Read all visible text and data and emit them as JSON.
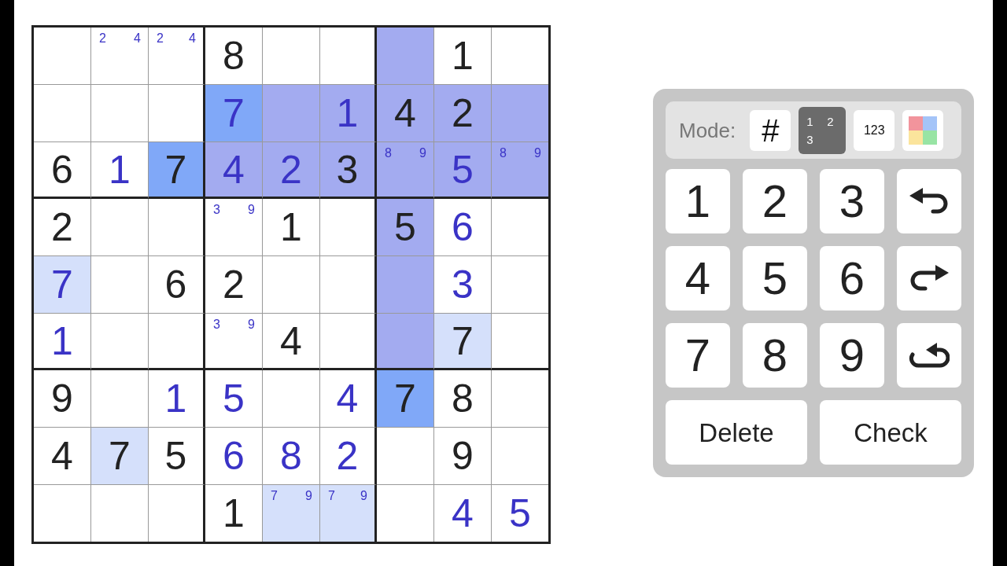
{
  "grid": {
    "rows": [
      [
        {
          "kind": "empty",
          "color": "#ffffff"
        },
        {
          "kind": "pencil",
          "marks": [
            "2",
            "4"
          ],
          "color": "#ffffff"
        },
        {
          "kind": "pencil",
          "marks": [
            "2",
            "4"
          ],
          "color": "#ffffff"
        },
        {
          "kind": "given",
          "value": "8",
          "color": "#ffffff"
        },
        {
          "kind": "empty",
          "color": "#ffffff"
        },
        {
          "kind": "empty",
          "color": "#ffffff"
        },
        {
          "kind": "empty",
          "color": "#a3abf0"
        },
        {
          "kind": "given",
          "value": "1",
          "color": "#ffffff"
        },
        {
          "kind": "empty",
          "color": "#ffffff"
        }
      ],
      [
        {
          "kind": "empty",
          "color": "#ffffff"
        },
        {
          "kind": "empty",
          "color": "#ffffff"
        },
        {
          "kind": "empty",
          "color": "#ffffff"
        },
        {
          "kind": "entry",
          "value": "7",
          "color": "#80a8f8"
        },
        {
          "kind": "empty",
          "color": "#a3abf0"
        },
        {
          "kind": "entry",
          "value": "1",
          "color": "#a3abf0"
        },
        {
          "kind": "given",
          "value": "4",
          "color": "#a3abf0"
        },
        {
          "kind": "given",
          "value": "2",
          "color": "#a3abf0"
        },
        {
          "kind": "empty",
          "color": "#a3abf0"
        }
      ],
      [
        {
          "kind": "given",
          "value": "6",
          "color": "#ffffff"
        },
        {
          "kind": "entry",
          "value": "1",
          "color": "#ffffff"
        },
        {
          "kind": "given",
          "value": "7",
          "color": "#80a8f8"
        },
        {
          "kind": "entry",
          "value": "4",
          "color": "#a3abf0"
        },
        {
          "kind": "entry",
          "value": "2",
          "color": "#a3abf0"
        },
        {
          "kind": "given",
          "value": "3",
          "color": "#a3abf0"
        },
        {
          "kind": "pencil",
          "marks": [
            "8",
            "9"
          ],
          "color": "#a3abf0"
        },
        {
          "kind": "entry",
          "value": "5",
          "color": "#a3abf0"
        },
        {
          "kind": "pencil",
          "marks": [
            "8",
            "9"
          ],
          "color": "#a3abf0"
        }
      ],
      [
        {
          "kind": "given",
          "value": "2",
          "color": "#ffffff"
        },
        {
          "kind": "empty",
          "color": "#ffffff"
        },
        {
          "kind": "empty",
          "color": "#ffffff"
        },
        {
          "kind": "pencil",
          "marks": [
            "3",
            "9"
          ],
          "color": "#ffffff"
        },
        {
          "kind": "given",
          "value": "1",
          "color": "#ffffff"
        },
        {
          "kind": "empty",
          "color": "#ffffff"
        },
        {
          "kind": "given",
          "value": "5",
          "color": "#a3abf0"
        },
        {
          "kind": "entry",
          "value": "6",
          "color": "#ffffff"
        },
        {
          "kind": "empty",
          "color": "#ffffff"
        }
      ],
      [
        {
          "kind": "entry",
          "value": "7",
          "color": "#d5e0fb"
        },
        {
          "kind": "empty",
          "color": "#ffffff"
        },
        {
          "kind": "given",
          "value": "6",
          "color": "#ffffff"
        },
        {
          "kind": "given",
          "value": "2",
          "color": "#ffffff"
        },
        {
          "kind": "empty",
          "color": "#ffffff"
        },
        {
          "kind": "empty",
          "color": "#ffffff"
        },
        {
          "kind": "empty",
          "color": "#a3abf0"
        },
        {
          "kind": "entry",
          "value": "3",
          "color": "#ffffff"
        },
        {
          "kind": "empty",
          "color": "#ffffff"
        }
      ],
      [
        {
          "kind": "entry",
          "value": "1",
          "color": "#ffffff"
        },
        {
          "kind": "empty",
          "color": "#ffffff"
        },
        {
          "kind": "empty",
          "color": "#ffffff"
        },
        {
          "kind": "pencil",
          "marks": [
            "3",
            "9"
          ],
          "color": "#ffffff"
        },
        {
          "kind": "given",
          "value": "4",
          "color": "#ffffff"
        },
        {
          "kind": "empty",
          "color": "#ffffff"
        },
        {
          "kind": "empty",
          "color": "#a3abf0"
        },
        {
          "kind": "given",
          "value": "7",
          "color": "#d5e0fb"
        },
        {
          "kind": "empty",
          "color": "#ffffff"
        }
      ],
      [
        {
          "kind": "given",
          "value": "9",
          "color": "#ffffff"
        },
        {
          "kind": "empty",
          "color": "#ffffff"
        },
        {
          "kind": "entry",
          "value": "1",
          "color": "#ffffff"
        },
        {
          "kind": "entry",
          "value": "5",
          "color": "#ffffff"
        },
        {
          "kind": "empty",
          "color": "#ffffff"
        },
        {
          "kind": "entry",
          "value": "4",
          "color": "#ffffff"
        },
        {
          "kind": "given",
          "value": "7",
          "color": "#80a8f8"
        },
        {
          "kind": "given",
          "value": "8",
          "color": "#ffffff"
        },
        {
          "kind": "empty",
          "color": "#ffffff"
        }
      ],
      [
        {
          "kind": "given",
          "value": "4",
          "color": "#ffffff"
        },
        {
          "kind": "given",
          "value": "7",
          "color": "#d5e0fb"
        },
        {
          "kind": "given",
          "value": "5",
          "color": "#ffffff"
        },
        {
          "kind": "entry",
          "value": "6",
          "color": "#ffffff"
        },
        {
          "kind": "entry",
          "value": "8",
          "color": "#ffffff"
        },
        {
          "kind": "entry",
          "value": "2",
          "color": "#ffffff"
        },
        {
          "kind": "empty",
          "color": "#ffffff"
        },
        {
          "kind": "given",
          "value": "9",
          "color": "#ffffff"
        },
        {
          "kind": "empty",
          "color": "#ffffff"
        }
      ],
      [
        {
          "kind": "empty",
          "color": "#ffffff"
        },
        {
          "kind": "empty",
          "color": "#ffffff"
        },
        {
          "kind": "empty",
          "color": "#ffffff"
        },
        {
          "kind": "given",
          "value": "1",
          "color": "#ffffff"
        },
        {
          "kind": "pencil",
          "marks": [
            "7",
            "9"
          ],
          "color": "#d5e0fb"
        },
        {
          "kind": "pencil",
          "marks": [
            "7",
            "9"
          ],
          "color": "#d5e0fb"
        },
        {
          "kind": "empty",
          "color": "#ffffff"
        },
        {
          "kind": "entry",
          "value": "4",
          "color": "#ffffff"
        },
        {
          "kind": "entry",
          "value": "5",
          "color": "#ffffff"
        }
      ]
    ]
  },
  "panel": {
    "mode_label": "Mode:",
    "modes": [
      {
        "kind": "normal",
        "label": "#",
        "selected": false
      },
      {
        "kind": "corner",
        "labels": [
          "1",
          "2",
          "3"
        ],
        "selected": true
      },
      {
        "kind": "center",
        "label": "123",
        "selected": false
      },
      {
        "kind": "color",
        "selected": false
      }
    ],
    "keys": [
      {
        "kind": "digit",
        "label": "1"
      },
      {
        "kind": "digit",
        "label": "2"
      },
      {
        "kind": "digit",
        "label": "3"
      },
      {
        "kind": "undo"
      },
      {
        "kind": "digit",
        "label": "4"
      },
      {
        "kind": "digit",
        "label": "5"
      },
      {
        "kind": "digit",
        "label": "6"
      },
      {
        "kind": "redo"
      },
      {
        "kind": "digit",
        "label": "7"
      },
      {
        "kind": "digit",
        "label": "8"
      },
      {
        "kind": "digit",
        "label": "9"
      },
      {
        "kind": "restart"
      },
      {
        "kind": "delete",
        "label": "Delete"
      },
      {
        "kind": "check",
        "label": "Check"
      }
    ]
  }
}
